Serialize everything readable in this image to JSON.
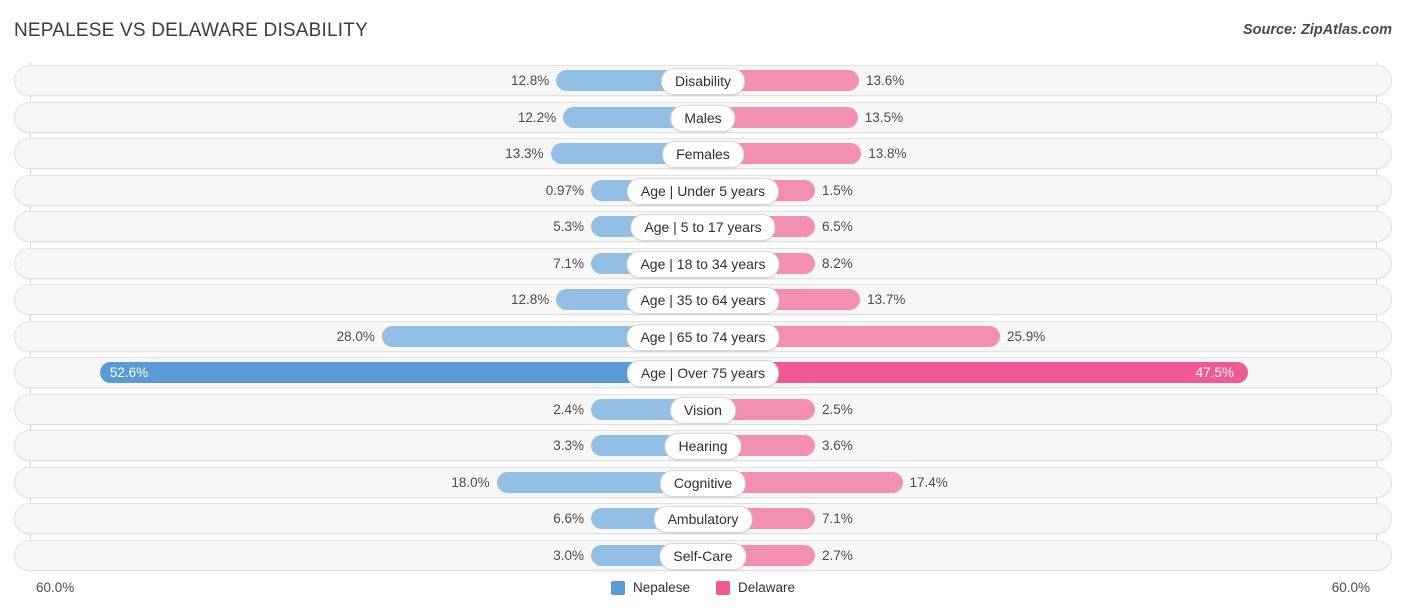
{
  "header": {
    "title": "NEPALESE VS DELAWARE DISABILITY",
    "source": "Source: ZipAtlas.com"
  },
  "axis": {
    "left_max_label": "60.0%",
    "right_max_label": "60.0%",
    "max_value": 60.0
  },
  "legend": {
    "items": [
      {
        "label": "Nepalese",
        "color": "#5b9bd5"
      },
      {
        "label": "Delaware",
        "color": "#ef5a92"
      }
    ]
  },
  "colors": {
    "nepalese_normal": "#94bfe5",
    "delaware_normal": "#f48fb4",
    "nepalese_highlight": "#5b9bd5",
    "delaware_highlight": "#ef5a92",
    "row_background": "#f7f7f7",
    "row_border": "#e2e2e2"
  },
  "chart_data": {
    "type": "bar",
    "title": "NEPALESE VS DELAWARE DISABILITY",
    "subtitle": "",
    "xlabel": "",
    "ylabel": "",
    "orientation": "horizontal-diverging",
    "xlim": [
      60.0,
      60.0
    ],
    "grid": true,
    "legend_position": "bottom-center",
    "categories": [
      "Disability",
      "Males",
      "Females",
      "Age | Under 5 years",
      "Age | 5 to 17 years",
      "Age | 18 to 34 years",
      "Age | 35 to 64 years",
      "Age | 65 to 74 years",
      "Age | Over 75 years",
      "Vision",
      "Hearing",
      "Cognitive",
      "Ambulatory",
      "Self-Care"
    ],
    "series": [
      {
        "name": "Nepalese",
        "values": [
          12.8,
          12.2,
          13.3,
          0.97,
          5.3,
          7.1,
          12.8,
          28.0,
          52.6,
          2.4,
          3.3,
          18.0,
          6.6,
          3.0
        ],
        "labels": [
          "12.8%",
          "12.2%",
          "13.3%",
          "0.97%",
          "5.3%",
          "7.1%",
          "12.8%",
          "28.0%",
          "52.6%",
          "2.4%",
          "3.3%",
          "18.0%",
          "6.6%",
          "3.0%"
        ]
      },
      {
        "name": "Delaware",
        "values": [
          13.6,
          13.5,
          13.8,
          1.5,
          6.5,
          8.2,
          13.7,
          25.9,
          47.5,
          2.5,
          3.6,
          17.4,
          7.1,
          2.7
        ],
        "labels": [
          "13.6%",
          "13.5%",
          "13.8%",
          "1.5%",
          "6.5%",
          "8.2%",
          "13.7%",
          "25.9%",
          "47.5%",
          "2.5%",
          "3.6%",
          "17.4%",
          "7.1%",
          "2.7%"
        ]
      }
    ],
    "highlight_row_index": 8
  }
}
